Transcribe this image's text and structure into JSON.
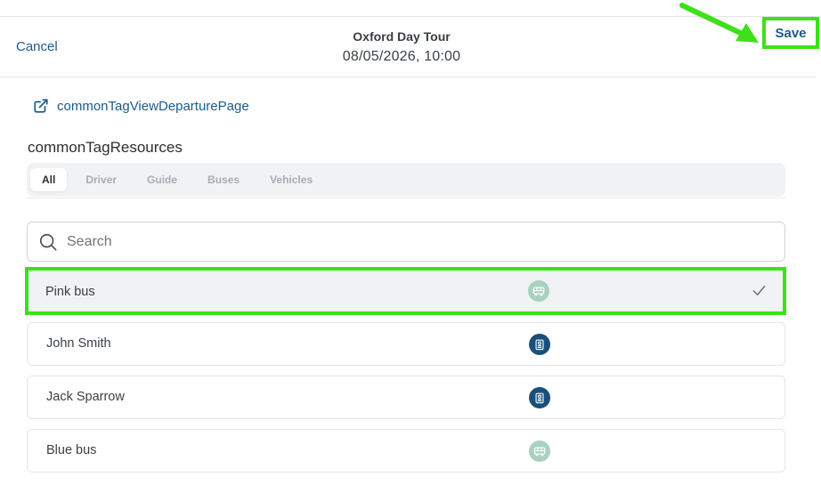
{
  "header": {
    "cancel_label": "Cancel",
    "title": "Oxford Day Tour",
    "datetime": "08/05/2026, 10:00",
    "save_label": "Save"
  },
  "view_link": {
    "label": "commonTagViewDeparturePage",
    "icon": "external-link-icon"
  },
  "resources": {
    "title": "commonTagResources",
    "tabs": [
      {
        "label": "All",
        "active": true
      },
      {
        "label": "Driver",
        "active": false
      },
      {
        "label": "Guide",
        "active": false
      },
      {
        "label": "Buses",
        "active": false
      },
      {
        "label": "Vehicles",
        "active": false
      }
    ],
    "search_placeholder": "Search",
    "items": [
      {
        "name": "Pink bus",
        "icon": "bus-icon",
        "selected": true
      },
      {
        "name": "John Smith",
        "icon": "person-badge-icon",
        "selected": false
      },
      {
        "name": "Jack Sparrow",
        "icon": "person-badge-icon",
        "selected": false
      },
      {
        "name": "Blue bus",
        "icon": "bus-icon",
        "selected": false
      }
    ]
  },
  "colors": {
    "accent": "#1d5a86",
    "highlight": "#3ee01c",
    "bus_icon_bg": "#a9d1bf",
    "person_icon_bg": "#1a4f7a"
  }
}
